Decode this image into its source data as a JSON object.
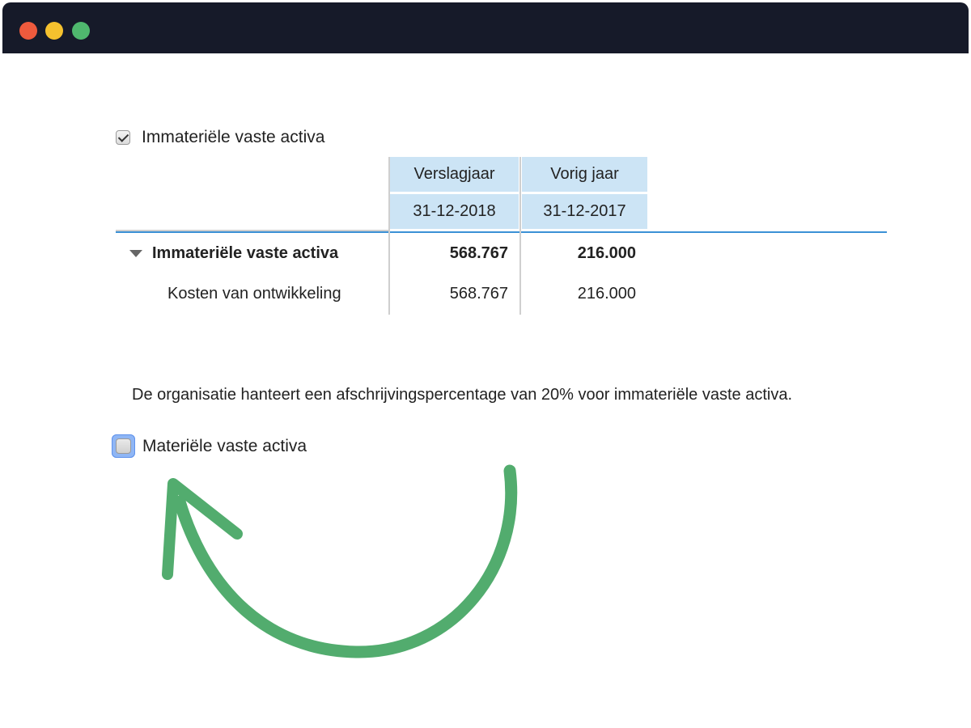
{
  "window": {
    "controls": [
      "close",
      "minimize",
      "maximize"
    ]
  },
  "section1": {
    "checkbox_checked": true,
    "label": "Immateriële vaste activa"
  },
  "table": {
    "headers": [
      {
        "period": "Verslagjaar",
        "date": "31-12-2018"
      },
      {
        "period": "Vorig jaar",
        "date": "31-12-2017"
      }
    ],
    "rows": [
      {
        "label": "Immateriële vaste activa",
        "values": [
          "568.767",
          "216.000"
        ],
        "bold": true,
        "expanded": true
      },
      {
        "label": "Kosten van ontwikkeling",
        "values": [
          "568.767",
          "216.000"
        ],
        "bold": false
      }
    ]
  },
  "note": "De organisatie hanteert een afschrijvingspercentage van 20% voor immateriële vaste activa.",
  "section2": {
    "checkbox_checked": false,
    "focused": true,
    "label": "Materiële vaste activa"
  },
  "colors": {
    "titlebar": "#161a29",
    "header_fill": "#cce4f5",
    "rule": "#3b91d6",
    "arrow": "#52ac6e"
  },
  "annotation": {
    "icon": "curved-arrow-icon"
  }
}
